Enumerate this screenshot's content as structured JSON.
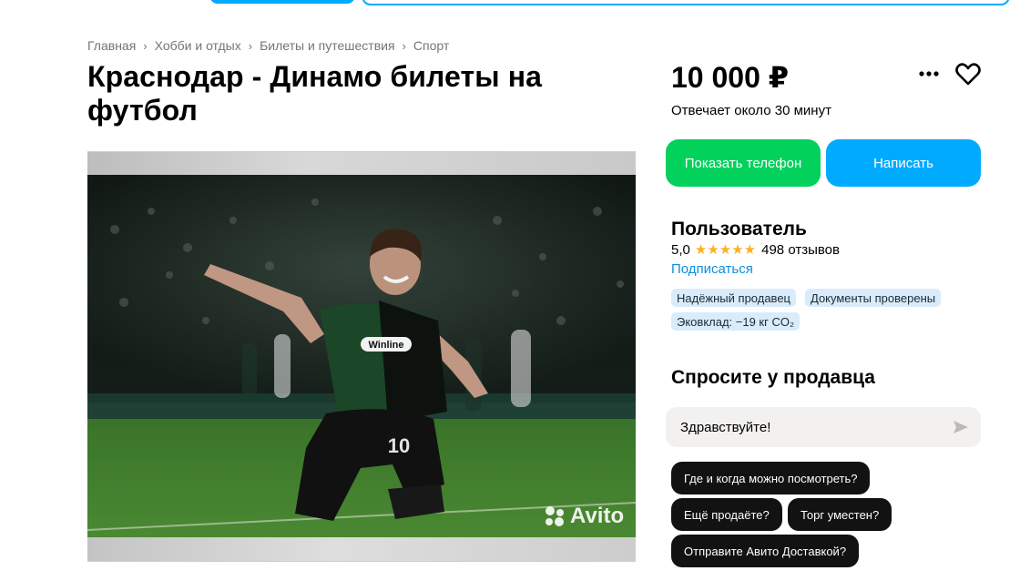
{
  "breadcrumbs": [
    "Главная",
    "Хобби и отдых",
    "Билеты и путешествия",
    "Спорт"
  ],
  "listing": {
    "title": "Краснодар - Динамо билеты на футбол",
    "price": "10 000 ₽",
    "response_time": "Отвечает около 30 минут"
  },
  "gallery": {
    "watermark": "Avito",
    "sponsor_text": "Winline",
    "jersey_number": "10"
  },
  "actions": {
    "show_phone": "Показать телефон",
    "write": "Написать"
  },
  "seller": {
    "name": "Пользователь",
    "rating": "5,0",
    "reviews": "498 отзывов",
    "subscribe": "Подписаться",
    "badges": [
      "Надёжный продавец",
      "Документы проверены",
      "Эковклад: −19 кг CO₂"
    ]
  },
  "ask": {
    "title": "Спросите у продавца",
    "message_value": "Здравствуйте!",
    "quick_questions": [
      "Где и когда можно посмотреть?",
      "Ещё продаёте?",
      "Торг уместен?",
      "Отправите Авито Доставкой?"
    ]
  },
  "icons": {
    "more": "more-dots-icon",
    "favorite": "heart-icon",
    "send": "send-icon",
    "breadcrumb_separator": "chevron-right-icon"
  },
  "colors": {
    "brand_blue": "#00aaff",
    "call_green": "#02d15c",
    "star": "#ffb021",
    "link": "#0a8fe0"
  }
}
